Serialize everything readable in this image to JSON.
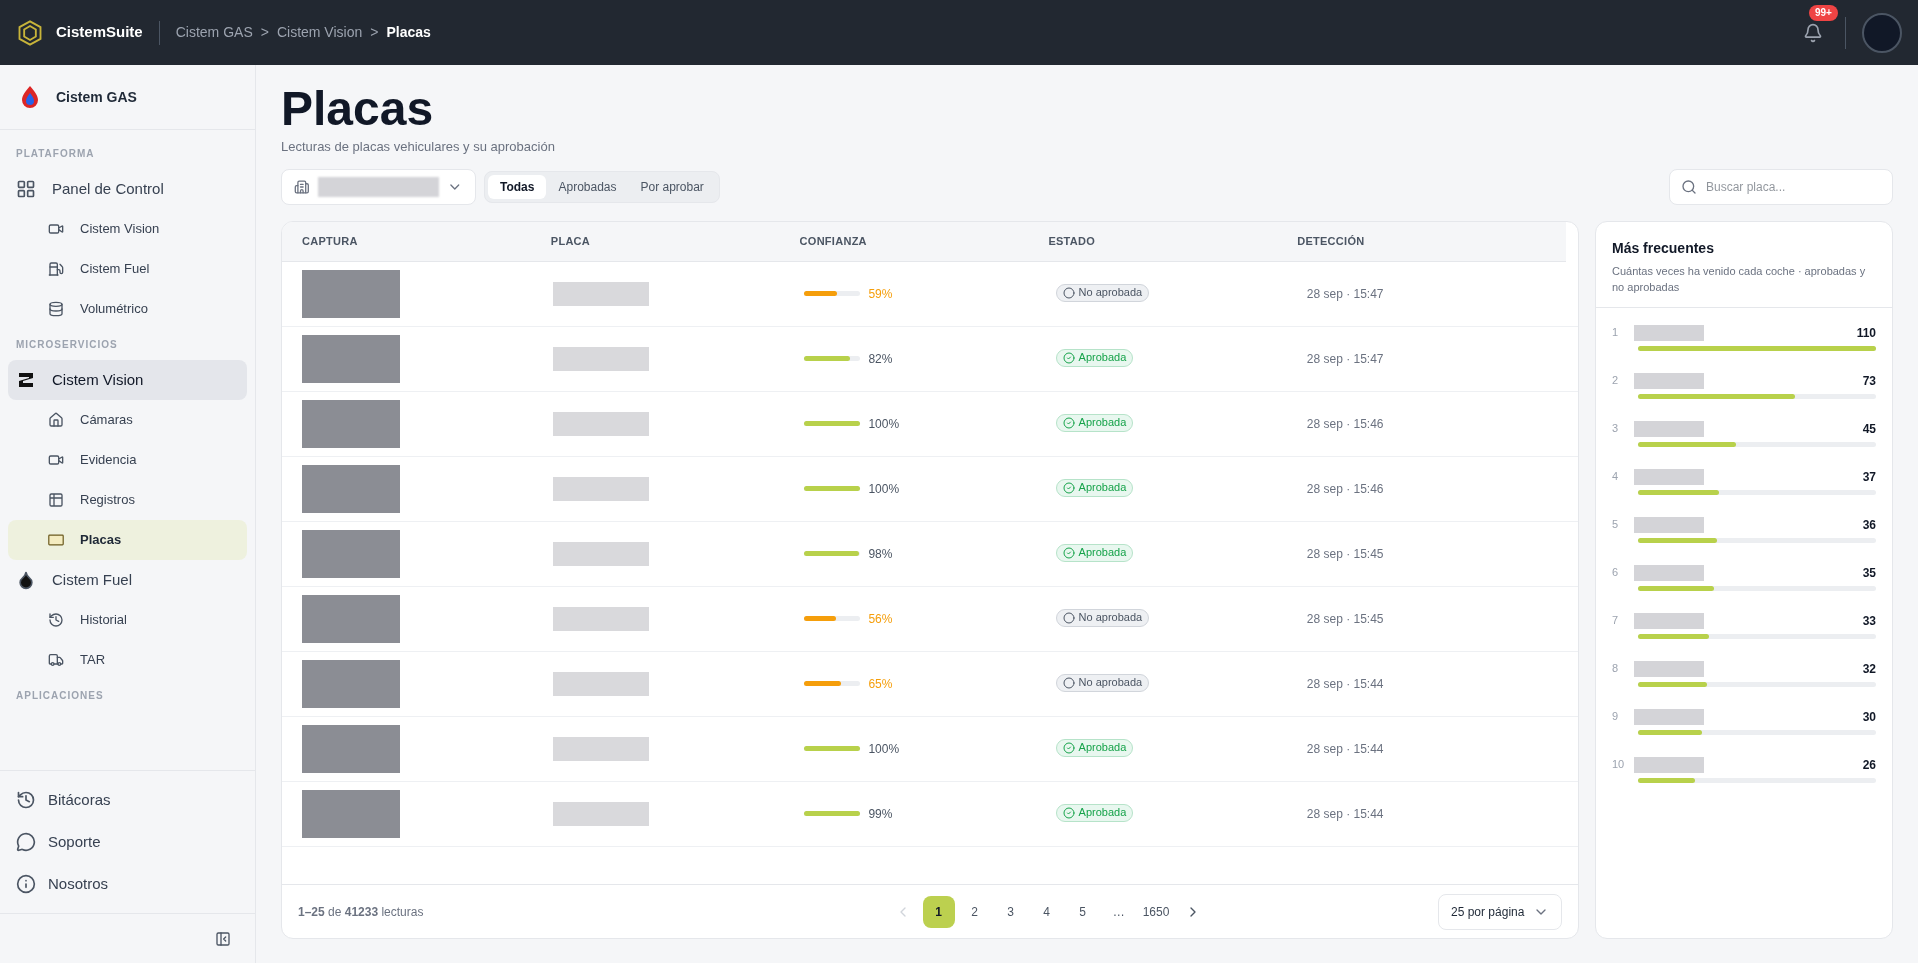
{
  "topbar": {
    "brand": "CistemSuite",
    "breadcrumbs": [
      {
        "label": "Cistem GAS",
        "current": false
      },
      {
        "label": "Cistem Vision",
        "current": false
      },
      {
        "label": "Placas",
        "current": true
      }
    ],
    "separator": ">",
    "notifications": "99+"
  },
  "sidebar": {
    "org": "Cistem GAS",
    "sections": [
      {
        "title": "PLATAFORMA",
        "items": [
          {
            "label": "Panel de Control",
            "selected": false,
            "children": [
              {
                "label": "Cistem Vision",
                "selected": false
              },
              {
                "label": "Cistem Fuel",
                "selected": false
              },
              {
                "label": "Volumétrico",
                "selected": false
              }
            ]
          }
        ]
      },
      {
        "title": "MICROSERVICIOS",
        "items": [
          {
            "label": "Cistem Vision",
            "selected": true,
            "children": [
              {
                "label": "Cámaras",
                "selected": false
              },
              {
                "label": "Evidencia",
                "selected": false
              },
              {
                "label": "Registros",
                "selected": false
              },
              {
                "label": "Placas",
                "selected": true
              }
            ]
          },
          {
            "label": "Cistem Fuel",
            "selected": false,
            "children": [
              {
                "label": "Historial",
                "selected": false
              },
              {
                "label": "TAR",
                "selected": false
              }
            ]
          }
        ]
      },
      {
        "title": "APLICACIONES"
      }
    ],
    "footer": [
      {
        "label": "Bitácoras"
      },
      {
        "label": "Soporte"
      },
      {
        "label": "Nosotros"
      }
    ]
  },
  "page": {
    "title": "Placas",
    "subtitle": "Lecturas de placas vehiculares y su aprobación"
  },
  "filters": {
    "tabs": [
      {
        "label": "Todas",
        "selected": true
      },
      {
        "label": "Aprobadas",
        "selected": false
      },
      {
        "label": "Por aprobar",
        "selected": false
      }
    ],
    "search": {
      "placeholder": "Buscar placa..."
    }
  },
  "table": {
    "columns": [
      "CAPTURA",
      "PLACA",
      "CONFIANZA",
      "ESTADO",
      "DETECCIÓN"
    ],
    "rows": [
      {
        "confidence": {
          "level": 0.59,
          "reading": "59%"
        },
        "status": {
          "kind": "pending",
          "label": "No aprobada"
        },
        "detected": "28 sep · 15:47"
      },
      {
        "confidence": {
          "level": 0.82,
          "reading": "82%"
        },
        "status": {
          "kind": "approved",
          "label": "Aprobada"
        },
        "detected": "28 sep · 15:47"
      },
      {
        "confidence": {
          "level": 1,
          "reading": "100%"
        },
        "status": {
          "kind": "approved",
          "label": "Aprobada"
        },
        "detected": "28 sep · 15:46"
      },
      {
        "confidence": {
          "level": 1,
          "reading": "100%"
        },
        "status": {
          "kind": "approved",
          "label": "Aprobada"
        },
        "detected": "28 sep · 15:46"
      },
      {
        "confidence": {
          "level": 0.98,
          "reading": "98%"
        },
        "status": {
          "kind": "approved",
          "label": "Aprobada"
        },
        "detected": "28 sep · 15:45"
      },
      {
        "confidence": {
          "level": 0.56,
          "reading": "56%"
        },
        "status": {
          "kind": "pending",
          "label": "No aprobada"
        },
        "detected": "28 sep · 15:45"
      },
      {
        "confidence": {
          "level": 0.65,
          "reading": "65%"
        },
        "status": {
          "kind": "pending",
          "label": "No aprobada"
        },
        "detected": "28 sep · 15:44"
      },
      {
        "confidence": {
          "level": 1,
          "reading": "100%"
        },
        "status": {
          "kind": "approved",
          "label": "Aprobada"
        },
        "detected": "28 sep · 15:44"
      },
      {
        "confidence": {
          "level": 0.99,
          "reading": "99%"
        },
        "status": {
          "kind": "approved",
          "label": "Aprobada"
        },
        "detected": "28 sep · 15:44"
      }
    ],
    "summary": "**1–25** de **41233** lecturas",
    "pages": [
      {
        "label": "1",
        "selected": true
      },
      {
        "label": "2",
        "selected": false
      },
      {
        "label": "3",
        "selected": false
      },
      {
        "label": "4",
        "selected": false
      },
      {
        "label": "5",
        "selected": false
      },
      {
        "label": "…",
        "selected": false
      },
      {
        "label": "1650",
        "selected": false
      }
    ],
    "per_page": "25 por página"
  },
  "frequent": {
    "title": "Más frecuentes",
    "subtitle": "Cuántas veces ha venido cada coche · aprobadas y no aprobadas",
    "items": [
      {
        "rank": "1",
        "count": "110",
        "level": 1
      },
      {
        "rank": "2",
        "count": "73",
        "level": 0.66
      },
      {
        "rank": "3",
        "count": "45",
        "level": 0.41
      },
      {
        "rank": "4",
        "count": "37",
        "level": 0.34
      },
      {
        "rank": "5",
        "count": "36",
        "level": 0.33
      },
      {
        "rank": "6",
        "count": "35",
        "level": 0.32
      },
      {
        "rank": "7",
        "count": "33",
        "level": 0.3
      },
      {
        "rank": "8",
        "count": "32",
        "level": 0.29
      },
      {
        "rank": "9",
        "count": "30",
        "level": 0.27
      },
      {
        "rank": "10",
        "count": "26",
        "level": 0.24
      }
    ]
  }
}
